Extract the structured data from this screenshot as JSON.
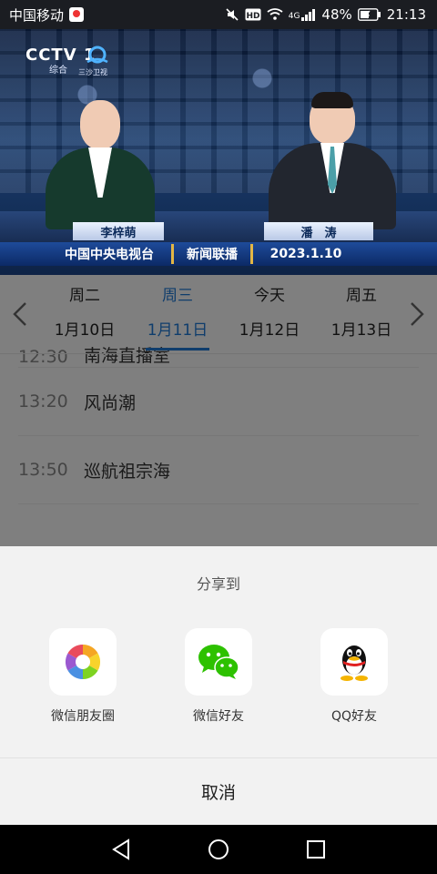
{
  "status_bar": {
    "carrier": "中国移动",
    "network": "4G",
    "battery": "48%",
    "time": "21:13",
    "icons": [
      "mute-icon",
      "hd-icon",
      "wifi-icon",
      "signal-icon",
      "battery-icon"
    ]
  },
  "video": {
    "channel_logo": "CCTV 1",
    "channel_sub": "综合",
    "watermark": "三沙卫视",
    "anchor_left": "李梓萌",
    "anchor_right": "潘　涛",
    "caption_left": "中国中央电视台",
    "caption_center": "新闻联播",
    "caption_right": "2023.1.10"
  },
  "date_nav": {
    "days": [
      {
        "name": "周二",
        "date": "1月10日",
        "active": false
      },
      {
        "name": "周三",
        "date": "1月11日",
        "active": true
      },
      {
        "name": "今天",
        "date": "1月12日",
        "active": false
      },
      {
        "name": "周五",
        "date": "1月13日",
        "active": false
      }
    ]
  },
  "programs": [
    {
      "time": "12:30",
      "title": "南海直播室"
    },
    {
      "time": "13:20",
      "title": "风尚潮"
    },
    {
      "time": "13:50",
      "title": "巡航祖宗海"
    }
  ],
  "share_sheet": {
    "title": "分享到",
    "targets": [
      {
        "label": "微信朋友圈",
        "icon": "moments-icon"
      },
      {
        "label": "微信好友",
        "icon": "wechat-icon"
      },
      {
        "label": "QQ好友",
        "icon": "qq-icon"
      }
    ],
    "cancel": "取消"
  },
  "colors": {
    "accent": "#1f7ad8",
    "wechat_green": "#2dc100",
    "sheet_bg": "#f2f2f2"
  }
}
